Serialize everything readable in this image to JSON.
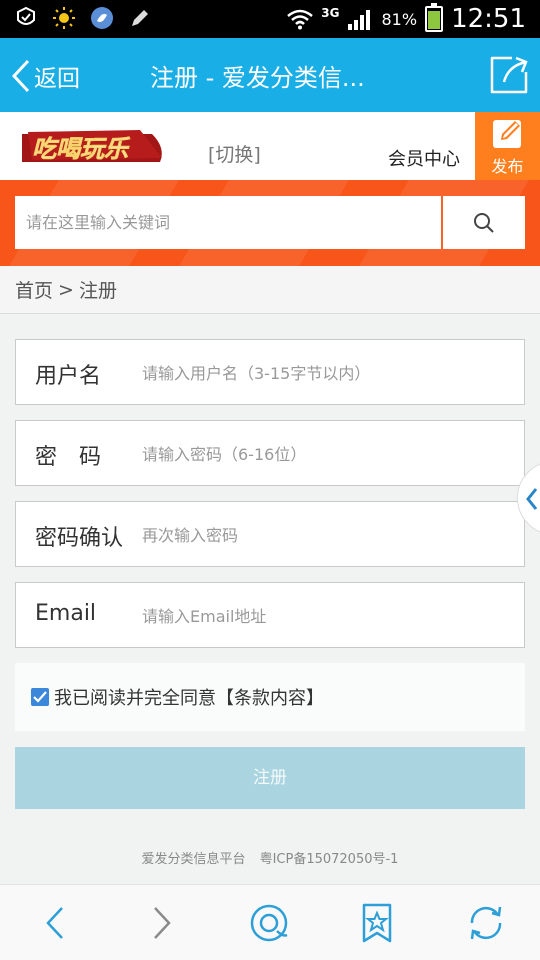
{
  "status_bar": {
    "network": "3G",
    "battery": "81%",
    "battery_level": 0.81,
    "time": "12:51"
  },
  "title_bar": {
    "back_label": "返回",
    "title": "注册 - 爱发分类信..."
  },
  "site_header": {
    "logo_text": "吃喝玩乐",
    "switch_label": "[切换]",
    "member_center_label": "会员中心",
    "publish_label": "发布"
  },
  "search": {
    "placeholder": "请在这里输入关键词"
  },
  "breadcrumb": {
    "home": "首页",
    "separator": ">",
    "current": "注册"
  },
  "form": {
    "username": {
      "label": "用户名",
      "placeholder": "请输入用户名（3-15字节以内）"
    },
    "password": {
      "label": "密　码",
      "placeholder": "请输入密码（6-16位）"
    },
    "confirm": {
      "label": "密码确认",
      "placeholder": "再次输入密码"
    },
    "email": {
      "label": "Email",
      "placeholder": "请输入Email地址"
    },
    "agree_text": "我已阅读并完全同意【条款内容】",
    "agree_checked": true,
    "submit_label": "注册"
  },
  "footer": {
    "platform": "爱发分类信息平台",
    "icp": "粤ICP备15072050号-1"
  },
  "colors": {
    "title_bar": "#1aaee6",
    "search_band": "#f8551a",
    "publish": "#ff7f1e",
    "submit": "#a9d4e0",
    "checkbox": "#3b87d9"
  },
  "icons": {
    "back": "chevron-left-icon",
    "share": "share-icon",
    "publish": "edit-icon",
    "search": "search-icon",
    "side_tab": "chevron-left-icon",
    "browser_back": "arrow-back-icon",
    "browser_forward": "arrow-forward-icon",
    "browser_home": "browser-home-icon",
    "bookmark": "bookmark-star-icon",
    "refresh": "refresh-icon"
  }
}
